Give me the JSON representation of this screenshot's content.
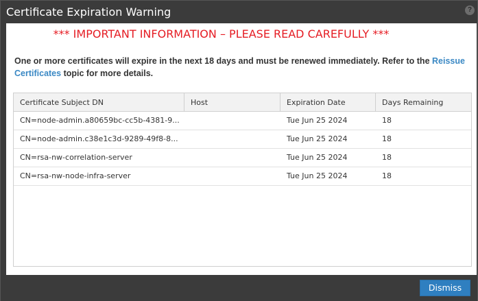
{
  "dialog": {
    "title": "Certificate Expiration Warning",
    "help_icon": "?",
    "important": "*** IMPORTANT INFORMATION – PLEASE READ CAREFULLY ***",
    "message_before": "One or more certificates will expire in the next 18 days and must be renewed immediately. Refer to the ",
    "message_link": "Reissue Certificates",
    "message_after": " topic for more details.",
    "dismiss_label": "Dismiss"
  },
  "grid": {
    "columns": [
      "Certificate Subject DN",
      "Host",
      "Expiration Date",
      "Days Remaining"
    ],
    "rows": [
      {
        "dn": "CN=node-admin.a80659bc-cc5b-4381-9...",
        "host": "",
        "date": "Tue Jun 25 2024",
        "days": "18"
      },
      {
        "dn": "CN=node-admin.c38e1c3d-9289-49f8-8...",
        "host": "",
        "date": "Tue Jun 25 2024",
        "days": "18"
      },
      {
        "dn": "CN=rsa-nw-correlation-server",
        "host": "",
        "date": "Tue Jun 25 2024",
        "days": "18"
      },
      {
        "dn": "CN=rsa-nw-node-infra-server",
        "host": "",
        "date": "Tue Jun 25 2024",
        "days": "18"
      }
    ]
  },
  "colors": {
    "important": "#e51c23",
    "link": "#3a88c4",
    "button": "#2f7fc0",
    "chrome": "#3b3b3b"
  }
}
